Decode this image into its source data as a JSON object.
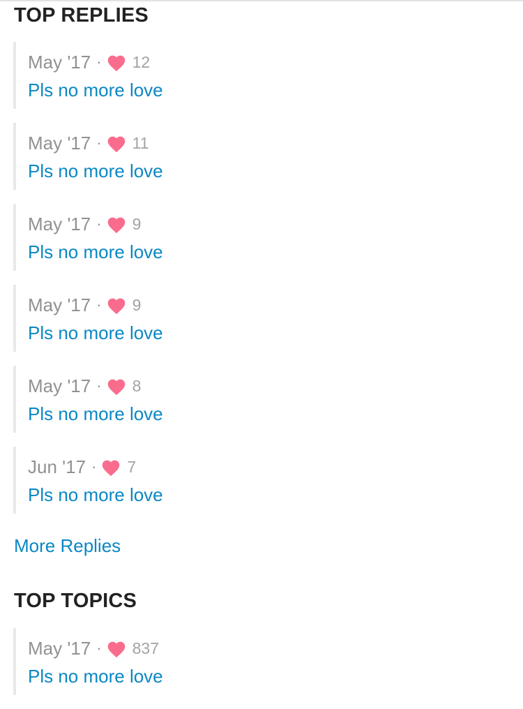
{
  "top_replies": {
    "heading": "TOP REPLIES",
    "items": [
      {
        "date": "May '17",
        "separator": "·",
        "likes": "12",
        "title": "Pls no more love"
      },
      {
        "date": "May '17",
        "separator": "·",
        "likes": "11",
        "title": "Pls no more love"
      },
      {
        "date": "May '17",
        "separator": "·",
        "likes": "9",
        "title": "Pls no more love"
      },
      {
        "date": "May '17",
        "separator": "·",
        "likes": "9",
        "title": "Pls no more love"
      },
      {
        "date": "May '17",
        "separator": "·",
        "likes": "8",
        "title": "Pls no more love"
      },
      {
        "date": "Jun '17",
        "separator": "·",
        "likes": "7",
        "title": "Pls no more love"
      }
    ],
    "more_label": "More Replies"
  },
  "top_topics": {
    "heading": "TOP TOPICS",
    "items": [
      {
        "date": "May '17",
        "separator": "·",
        "likes": "837",
        "title": "Pls no more love"
      }
    ]
  },
  "icons": {
    "like": "heart-icon"
  },
  "colors": {
    "link": "#0a87c4",
    "heart": "#fa6c8d",
    "meta_text": "#919191",
    "heading": "#222222",
    "border": "#e9e9e9"
  }
}
